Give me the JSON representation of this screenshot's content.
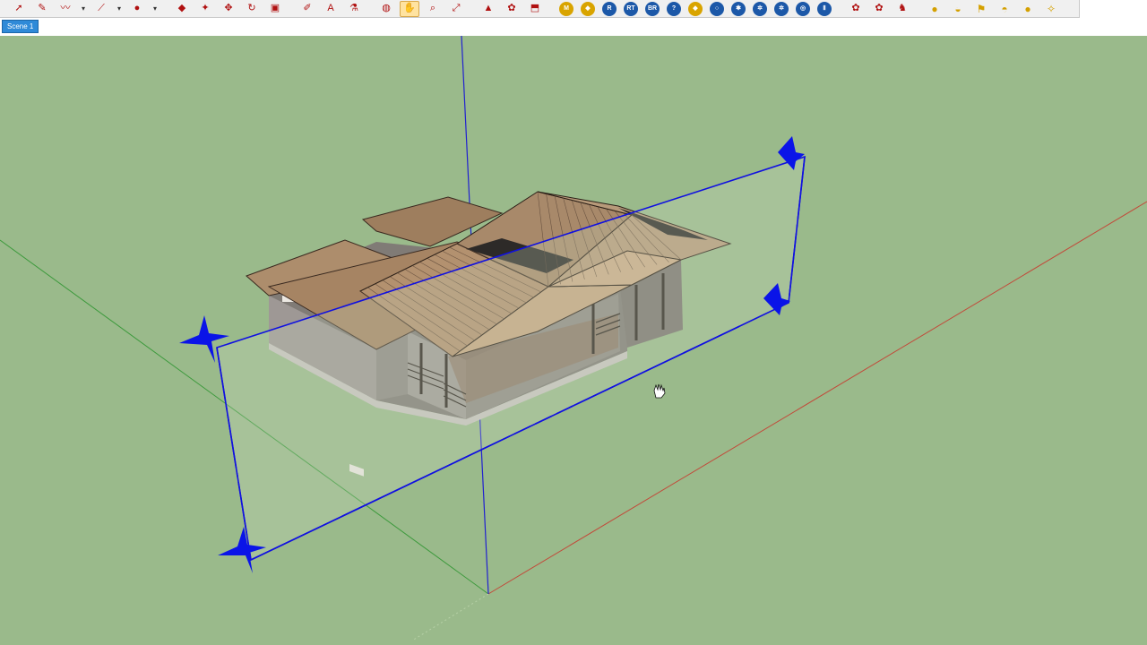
{
  "toolbar": {
    "groups": [
      [
        {
          "name": "select-icon",
          "glyph": "➚"
        },
        {
          "name": "eraser-icon",
          "glyph": "✎"
        },
        {
          "name": "freehand-icon",
          "glyph": "〰"
        },
        {
          "name": "dropdown-icon",
          "glyph": "▾"
        },
        {
          "name": "line-icon",
          "glyph": "⟋"
        },
        {
          "name": "dropdown-icon",
          "glyph": "▾"
        },
        {
          "name": "circle-icon",
          "glyph": "●"
        },
        {
          "name": "dropdown-icon",
          "glyph": "▾"
        }
      ],
      [
        {
          "name": "pushpull-icon",
          "glyph": "◆"
        },
        {
          "name": "followme-icon",
          "glyph": "✦"
        },
        {
          "name": "move-icon",
          "glyph": "✥"
        },
        {
          "name": "rotate-icon",
          "glyph": "↻"
        },
        {
          "name": "scale-icon",
          "glyph": "▣"
        }
      ],
      [
        {
          "name": "tape-measure-icon",
          "glyph": "✐"
        },
        {
          "name": "text-icon",
          "glyph": "A"
        },
        {
          "name": "paint-bucket-icon",
          "glyph": "⚗"
        }
      ],
      [
        {
          "name": "orbit-icon",
          "glyph": "◍"
        },
        {
          "name": "pan-icon",
          "glyph": "✋",
          "active": true
        },
        {
          "name": "zoom-icon",
          "glyph": "⌕"
        },
        {
          "name": "zoom-extents-icon",
          "glyph": "⤢"
        }
      ],
      [
        {
          "name": "warehouse-icon",
          "glyph": "▲"
        },
        {
          "name": "extension-icon",
          "glyph": "✿"
        },
        {
          "name": "share-model-icon",
          "glyph": "⬒"
        }
      ]
    ],
    "label_buttons": [
      {
        "name": "plugin-m-icon",
        "text": "M",
        "gold": true
      },
      {
        "name": "plugin-tag-icon",
        "text": "◆",
        "gold": true
      },
      {
        "name": "plugin-r-icon",
        "text": "R"
      },
      {
        "name": "plugin-rt-icon",
        "text": "RT"
      },
      {
        "name": "plugin-br-icon",
        "text": "BR"
      },
      {
        "name": "help-icon",
        "text": "?"
      },
      {
        "name": "plugin-diamond-icon",
        "text": "◆",
        "gold": true
      },
      {
        "name": "plugin-sphere-icon",
        "text": "○"
      },
      {
        "name": "plugin-star-icon",
        "text": "✱"
      },
      {
        "name": "plugin-plant-icon",
        "text": "✲"
      },
      {
        "name": "plugin-plant2-icon",
        "text": "✲"
      },
      {
        "name": "plugin-target-icon",
        "text": "◎"
      },
      {
        "name": "pause-icon",
        "text": "Ⅱ"
      }
    ],
    "extra_buttons": [
      {
        "name": "plugin-flower-red-icon",
        "glyph": "✿"
      },
      {
        "name": "plugin-flower-green-icon",
        "glyph": "✿"
      },
      {
        "name": "plugin-character-icon",
        "glyph": "♞"
      }
    ],
    "light_buttons": [
      {
        "name": "light-bulb-icon",
        "glyph": "●"
      },
      {
        "name": "light-spot-icon",
        "glyph": "◒"
      },
      {
        "name": "light-flag-icon",
        "glyph": "⚑"
      },
      {
        "name": "light-dome-icon",
        "glyph": "◓"
      },
      {
        "name": "light-sphere-icon",
        "glyph": "●"
      },
      {
        "name": "light-wand-icon",
        "glyph": "✧"
      }
    ]
  },
  "scenes": {
    "tabs": [
      {
        "label": "Scene 1"
      }
    ]
  },
  "colors": {
    "ground": "#9aba8b",
    "section_plane": "#1010e0",
    "axis_red": "#c24a3a",
    "axis_green": "#3c9a3c",
    "axis_blue": "#2020d0"
  }
}
